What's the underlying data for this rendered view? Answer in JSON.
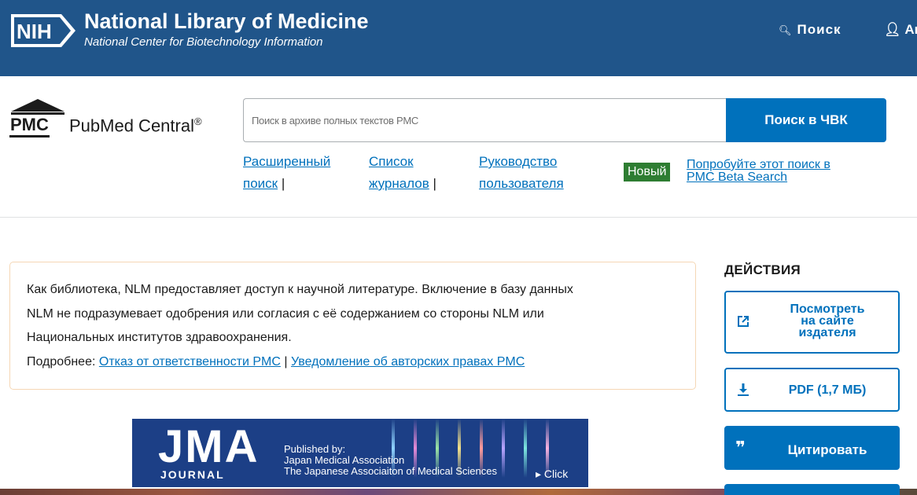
{
  "header": {
    "nih_abbr": "NIH",
    "title": "National Library of Medicine",
    "subtitle": "National Center for Biotechnology Information",
    "search_label": "Поиск",
    "account_label": "Аккаунт",
    "bg_color": "#20558a"
  },
  "pmc": {
    "abbr": "PMC",
    "name": "PubMed Central",
    "reg": "®",
    "search_placeholder": "Поиск в архиве полных текстов PMC",
    "search_button": "Поиск в ЧВК",
    "links": [
      {
        "line1": "Расширенный",
        "line2": "поиск"
      },
      {
        "line1": "Список",
        "line2": "журналов"
      },
      {
        "line1": "Руководство",
        "line2": "пользователя"
      }
    ],
    "separator": "|",
    "new_badge": "Новый",
    "beta_line1": "Попробуйте этот поиск в",
    "beta_line2": "PMC Beta Search",
    "accent_color": "#0071bc"
  },
  "disclaimer": {
    "line1": "Как библиотека, NLM предоставляет доступ к научной литературе. Включение в базу данных",
    "line2": "NLM не подразумевает одобрения или согласия с её содержанием со стороны NLM или",
    "line3": "Национальных институтов здравоохранения.",
    "more_label": "Подробнее:",
    "link1": "Отказ от ответственности PMC",
    "sep": "|",
    "link2": "Уведомление об авторских правах PMC"
  },
  "banner": {
    "logo": "JMA",
    "journal": "JOURNAL",
    "published_by": "Published by:",
    "publisher1": "Japan Medical Association",
    "publisher2": "The Japanese Associaiton of Medical Sciences",
    "click": "▸ Click"
  },
  "actions": {
    "title": "ДЕЙСТВИЯ",
    "publisher_site": {
      "line1": "Посмотреть",
      "line2": "на сайте",
      "line3": "издателя",
      "icon": "external-link-icon"
    },
    "pdf": {
      "label": "PDF (1,7 МБ)",
      "icon": "download-icon"
    },
    "cite": {
      "label": "Цитировать",
      "icon": "quote-icon"
    }
  }
}
